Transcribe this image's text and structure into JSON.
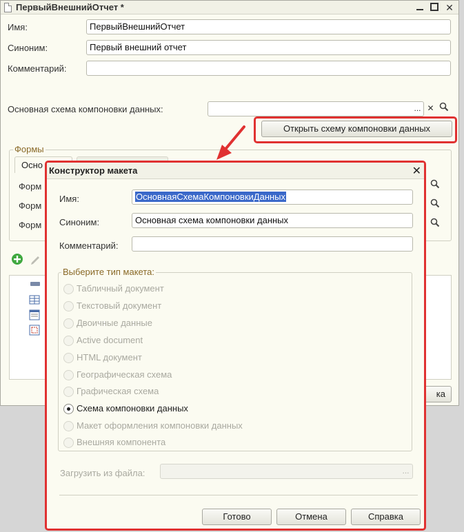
{
  "main_window": {
    "title": "ПервыйВнешнийОтчет *",
    "close_glyph": "✕",
    "fields": {
      "name_label": "Имя:",
      "name_value": "ПервыйВнешнийОтчет",
      "synonym_label": "Синоним:",
      "synonym_value": "Первый внешний отчет",
      "comment_label": "Комментарий:",
      "comment_value": "",
      "schema_label": "Основная схема компоновки данных:",
      "schema_value": ""
    },
    "field_buttons": {
      "ellipsis": "...",
      "clear": "✕"
    },
    "open_schema_button": "Открыть схему компоновки данных",
    "forms_group_title": "Формы",
    "forms_tab_label": "Осно",
    "form_row_labels": [
      "Форм",
      "Форм",
      "Форм"
    ],
    "partial_button_text": "ка"
  },
  "dialog": {
    "title": "Конструктор макета",
    "close_glyph": "✕",
    "name_label": "Имя:",
    "name_value": "ОсновнаяСхемаКомпоновкиДанных",
    "synonym_label": "Синоним:",
    "synonym_value": "Основная схема компоновки данных",
    "comment_label": "Комментарий:",
    "comment_value": "",
    "type_group_title": "Выберите тип макета:",
    "template_types": [
      {
        "label": "Табличный документ",
        "selected": false
      },
      {
        "label": "Текстовый документ",
        "selected": false
      },
      {
        "label": "Двоичные данные",
        "selected": false
      },
      {
        "label": "Active document",
        "selected": false
      },
      {
        "label": "HTML документ",
        "selected": false
      },
      {
        "label": "Географическая схема",
        "selected": false
      },
      {
        "label": "Графическая схема",
        "selected": false
      },
      {
        "label": "Схема компоновки данных",
        "selected": true
      },
      {
        "label": "Макет оформления компоновки данных",
        "selected": false
      },
      {
        "label": "Внешняя компонента",
        "selected": false
      }
    ],
    "load_file_label": "Загрузить из файла:",
    "load_file_value": "",
    "load_file_button": "...",
    "buttons": {
      "done": "Готово",
      "cancel": "Отмена",
      "help": "Справка"
    }
  },
  "colors": {
    "highlight": "#e03131",
    "selection": "#3a68c9",
    "group_title": "#8a6a28",
    "window_bg": "#fbfbf1"
  }
}
